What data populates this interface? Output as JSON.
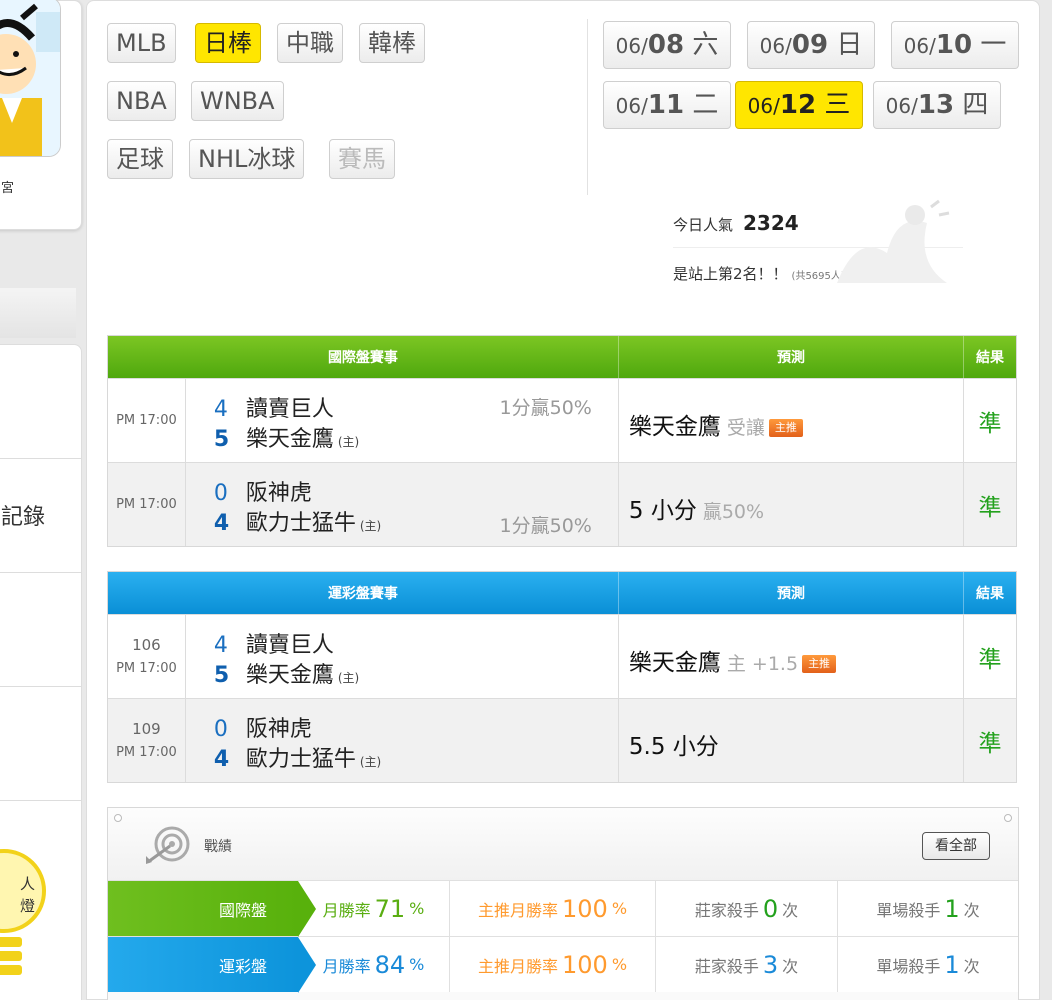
{
  "left": {
    "avatar_caption": "宮",
    "menu_items": [
      "",
      "記錄",
      "",
      "",
      ""
    ],
    "bulb_text": [
      "人",
      "燈"
    ]
  },
  "sport_tabs": [
    {
      "label": "MLB",
      "state": "normal"
    },
    {
      "label": "日棒",
      "state": "active"
    },
    {
      "label": "中職",
      "state": "normal"
    },
    {
      "label": "韓棒",
      "state": "normal"
    },
    {
      "label": "NBA",
      "state": "normal"
    },
    {
      "label": "WNBA",
      "state": "normal"
    },
    {
      "label": "足球",
      "state": "normal"
    },
    {
      "label": "NHL冰球",
      "state": "normal"
    },
    {
      "label": "賽馬",
      "state": "disabled"
    }
  ],
  "dates": [
    {
      "prefix": "06/",
      "day": "08",
      "weekday": "六",
      "active": false
    },
    {
      "prefix": "06/",
      "day": "09",
      "weekday": "日",
      "active": false
    },
    {
      "prefix": "06/",
      "day": "10",
      "weekday": "一",
      "active": false
    },
    {
      "prefix": "06/",
      "day": "11",
      "weekday": "二",
      "active": false
    },
    {
      "prefix": "06/",
      "day": "12",
      "weekday": "三",
      "active": true
    },
    {
      "prefix": "06/",
      "day": "13",
      "weekday": "四",
      "active": false
    }
  ],
  "popularity": {
    "label": "今日人氣",
    "value": "2324",
    "rank_text": "是站上第2名！！",
    "rank_total": "(共5695人)"
  },
  "intl_table": {
    "headers": [
      "國際盤賽事",
      "預測",
      "結果"
    ],
    "rows": [
      {
        "time": "PM 17:00",
        "code": "",
        "away_score": "4",
        "away": "讀賣巨人",
        "home_score": "5",
        "home": "樂天金鷹",
        "home_tag": "(主)",
        "spread": "1分贏50%",
        "spread_row": 1,
        "pred": "樂天金鷹",
        "pred_note": "受讓",
        "badge": "主推",
        "result": "準"
      },
      {
        "time": "PM 17:00",
        "code": "",
        "away_score": "0",
        "away": "阪神虎",
        "home_score": "4",
        "home": "歐力士猛牛",
        "home_tag": "(主)",
        "spread": "1分贏50%",
        "spread_row": 2,
        "pred": "5 小分",
        "pred_note": "贏50%",
        "badge": "",
        "result": "準"
      }
    ]
  },
  "sports_table": {
    "headers": [
      "運彩盤賽事",
      "預測",
      "結果"
    ],
    "rows": [
      {
        "time": "PM 17:00",
        "code": "106",
        "away_score": "4",
        "away": "讀賣巨人",
        "home_score": "5",
        "home": "樂天金鷹",
        "home_tag": "(主)",
        "spread": "",
        "spread_row": 0,
        "pred": "樂天金鷹",
        "pred_note": "主 +1.5",
        "badge": "主推",
        "result": "準"
      },
      {
        "time": "PM 17:00",
        "code": "109",
        "away_score": "0",
        "away": "阪神虎",
        "home_score": "4",
        "home": "歐力士猛牛",
        "home_tag": "(主)",
        "spread": "",
        "spread_row": 0,
        "pred": "5.5 小分",
        "pred_note": "",
        "badge": "",
        "result": "準"
      }
    ]
  },
  "stats": {
    "title": "戰績",
    "see_all": "看全部",
    "rows": [
      {
        "label": "國際盤",
        "month_label": "月勝率",
        "month_value": "71",
        "top_label": "主推月勝率",
        "top_value": "100",
        "pct": "%",
        "killer_label": "莊家殺手",
        "killer_value": "0",
        "single_label": "單場殺手",
        "single_value": "1",
        "times": "次"
      },
      {
        "label": "運彩盤",
        "month_label": "月勝率",
        "month_value": "84",
        "top_label": "主推月勝率",
        "top_value": "100",
        "pct": "%",
        "killer_label": "莊家殺手",
        "killer_value": "3",
        "single_label": "單場殺手",
        "single_value": "1",
        "times": "次"
      }
    ]
  },
  "colors": {
    "accent_yellow": "#ffe600",
    "intl_green": "#5aae12",
    "sports_blue": "#0a8fd6",
    "result_green": "#23a11d",
    "top_orange": "#ff9a2e"
  }
}
